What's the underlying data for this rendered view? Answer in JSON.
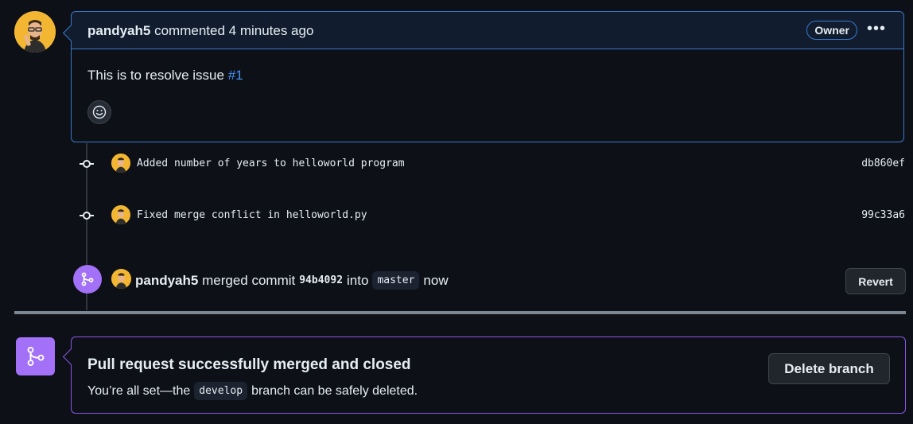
{
  "comment": {
    "author": "pandyah5",
    "meta": "commented 4 minutes ago",
    "badge": "Owner",
    "menu_icon": "kebab-horizontal-icon",
    "body_text": "This is to resolve issue",
    "issue_link": "#1",
    "reaction_icon": "smiley-icon"
  },
  "commits": [
    {
      "message": "Added number of years to helloworld program",
      "sha": "db860ef"
    },
    {
      "message": "Fixed merge conflict in helloworld.py",
      "sha": "99c33a6"
    }
  ],
  "merge_event": {
    "author": "pandyah5",
    "action": "merged commit",
    "commit": "94b4092",
    "into": "into",
    "branch": "master",
    "time": "now",
    "revert_label": "Revert"
  },
  "merged_box": {
    "title": "Pull request successfully merged and closed",
    "sub_prefix": "You’re all set—the",
    "branch": "develop",
    "sub_suffix": "branch can be safely deleted.",
    "delete_label": "Delete branch"
  },
  "colors": {
    "background": "#0d1117",
    "accent_blue": "#3a78c9",
    "merged_purple": "#a371f7",
    "link_blue": "#4493f8"
  }
}
